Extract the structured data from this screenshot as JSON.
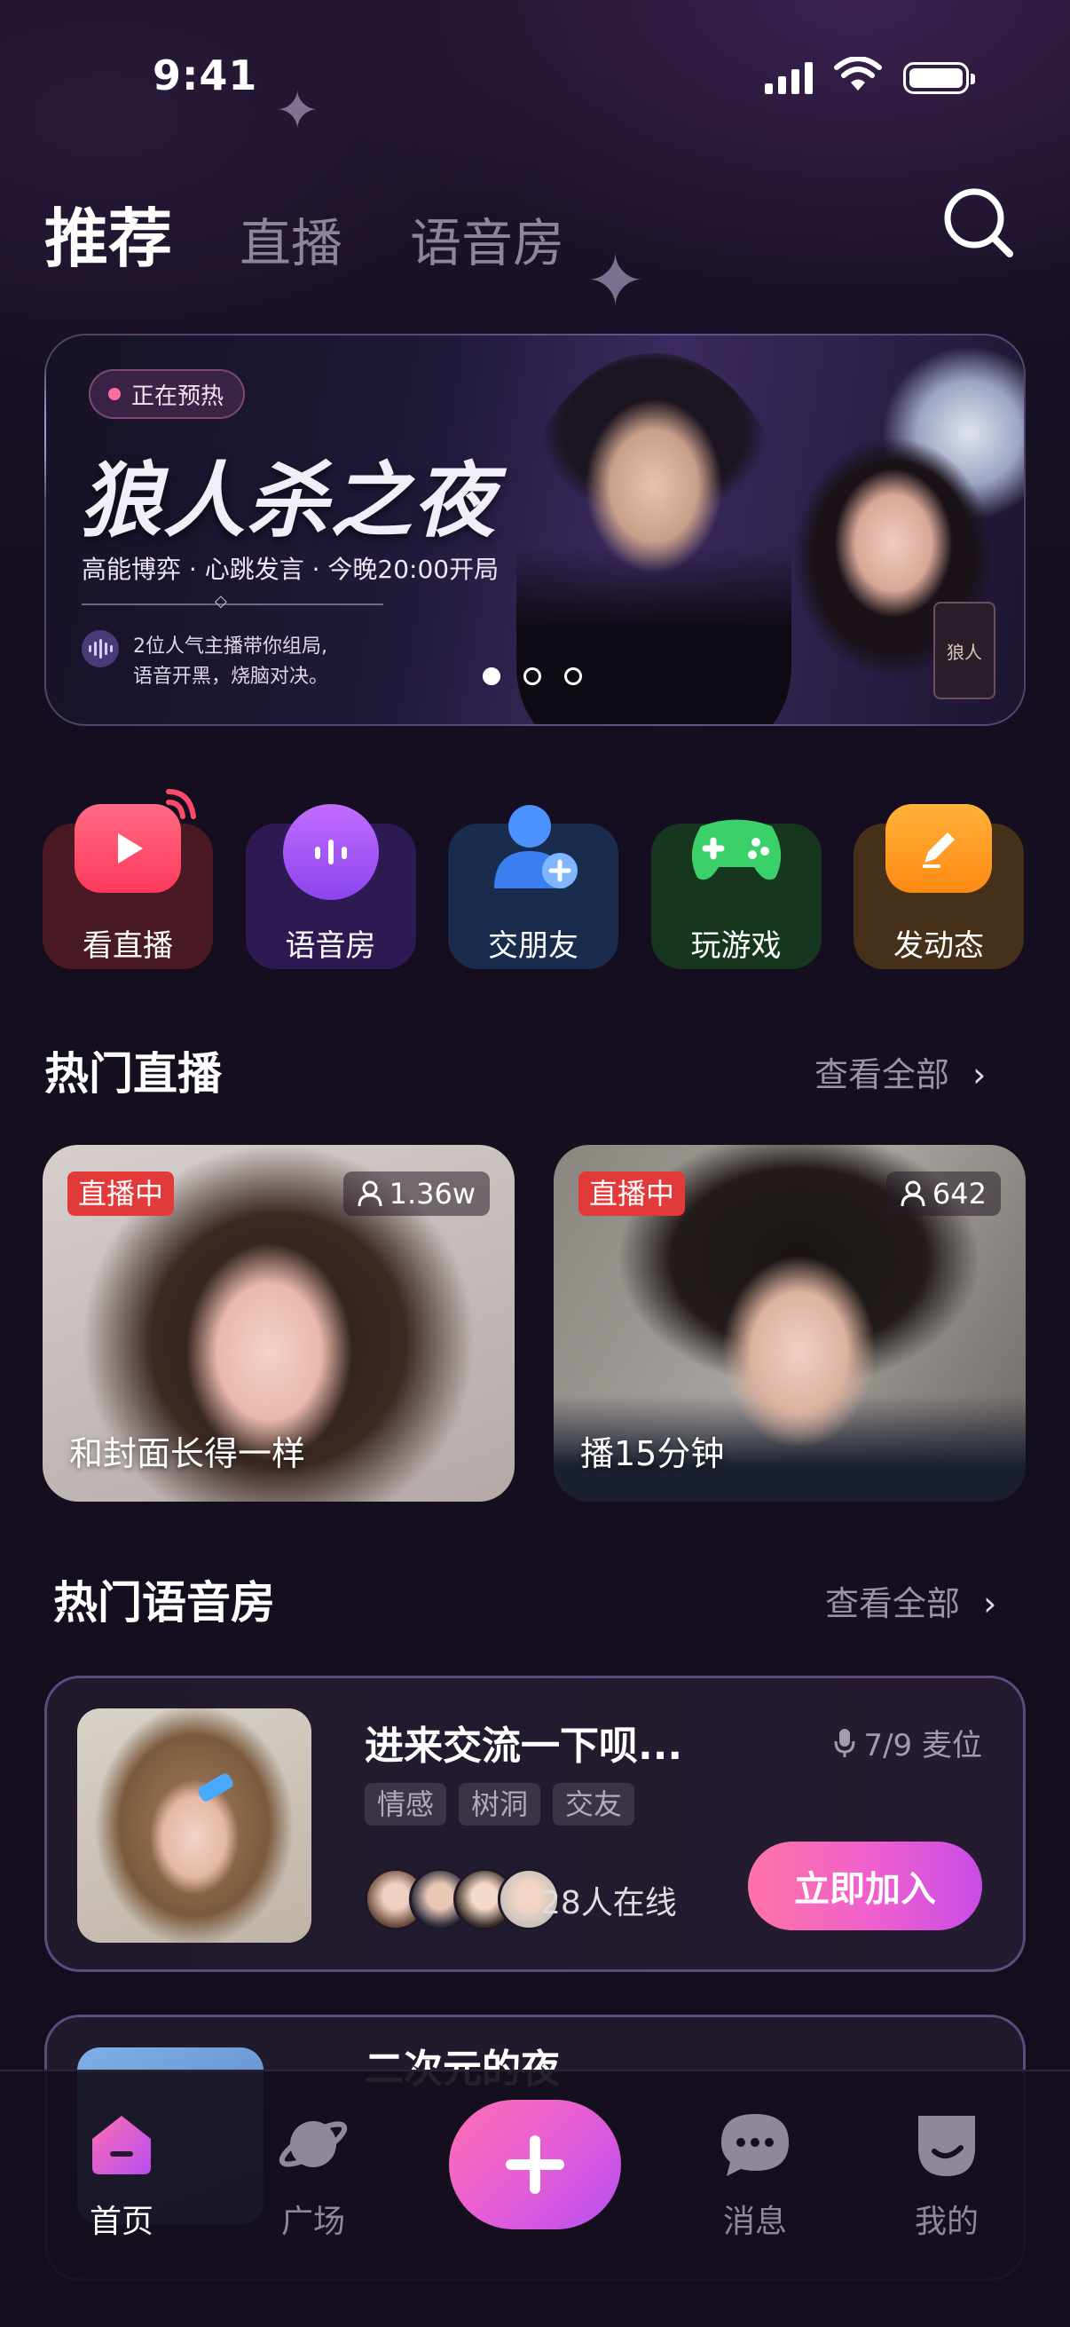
{
  "status_bar": {
    "time": "9:41"
  },
  "top_tabs": [
    {
      "label": "推荐",
      "active": true
    },
    {
      "label": "直播",
      "active": false
    },
    {
      "label": "语音房",
      "active": false
    }
  ],
  "banner": {
    "badge": "正在预热",
    "title": "狼人杀之夜",
    "subtitle": "高能博弈 · 心跳发言 · 今晚20:00开局",
    "desc_line1": "2位人气主播带你组局,",
    "desc_line2": "语音开黑，烧脑对决。",
    "card_text": "狼人",
    "slides": 3,
    "active_slide": 1
  },
  "quick_actions": [
    {
      "label": "看直播",
      "icon": "play-icon",
      "card_color": "#4a1a24",
      "icon_color": "#ff4a6a"
    },
    {
      "label": "语音房",
      "icon": "voice-chat-icon",
      "card_color": "#2e1a52",
      "icon_color": "#a35cf5"
    },
    {
      "label": "交朋友",
      "icon": "add-friend-icon",
      "card_color": "#1a2c4e",
      "icon_color": "#3d8bff"
    },
    {
      "label": "玩游戏",
      "icon": "gamepad-icon",
      "card_color": "#17361f",
      "icon_color": "#3bd16a"
    },
    {
      "label": "发动态",
      "icon": "edit-icon",
      "card_color": "#47301a",
      "icon_color": "#ff9d1f"
    }
  ],
  "hot_live": {
    "title": "热门直播",
    "more": "查看全部",
    "items": [
      {
        "tag": "直播中",
        "viewers": "1.36w",
        "caption": "和封面长得一样"
      },
      {
        "tag": "直播中",
        "viewers": "642",
        "caption": "播15分钟"
      }
    ]
  },
  "hot_voice": {
    "title": "热门语音房",
    "more": "查看全部",
    "rooms": [
      {
        "title": "进来交流一下呗...",
        "seats": "7/9 麦位",
        "tags": [
          "情感",
          "树洞",
          "交友"
        ],
        "online": "28人在线",
        "join": "立即加入"
      },
      {
        "title": "二次元的夜"
      }
    ]
  },
  "bottom_nav": [
    {
      "label": "首页",
      "icon": "home-icon",
      "active": true
    },
    {
      "label": "广场",
      "icon": "planet-icon",
      "active": false
    },
    {
      "label": "",
      "icon": "plus-icon",
      "active": false
    },
    {
      "label": "消息",
      "icon": "message-icon",
      "active": false
    },
    {
      "label": "我的",
      "icon": "profile-icon",
      "active": false
    }
  ],
  "colors": {
    "accent_pink": "#ff74a6",
    "accent_purple": "#c84ce6",
    "live_red": "#e23a3a",
    "bg": "#130d1c"
  }
}
